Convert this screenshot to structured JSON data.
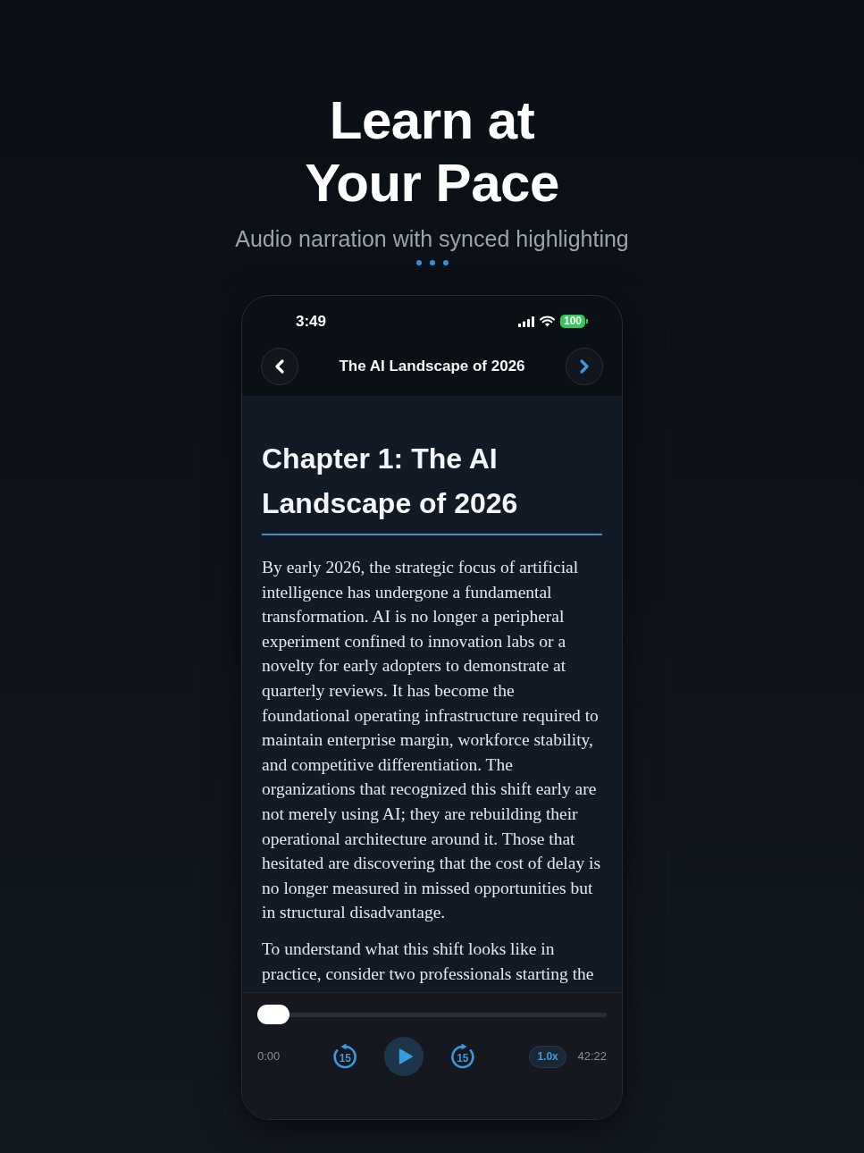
{
  "hero": {
    "title": "Learn at Your Pace",
    "subtitle": "Audio narration with synced highlighting"
  },
  "phone": {
    "status_bar": {
      "time": "3:49",
      "battery": "100"
    },
    "nav": {
      "title": "The AI Landscape of 2026"
    },
    "chapter": {
      "heading": "Chapter 1: The AI Landscape of 2026",
      "paragraphs": [
        "By early 2026, the strategic focus of artificial intelligence has undergone a fundamental transformation. AI is no longer a peripheral experiment confined to innovation labs or a novelty for early adopters to demonstrate at quarterly reviews. It has become the foundational operating infrastructure required to maintain enterprise margin, workforce stability, and competitive differentiation. The organizations that recognized this shift early are not merely using AI; they are rebuilding their operational architecture around it. Those that hesitated are discovering that the cost of delay is no longer measured in missed opportunities but in structural disadvantage.",
        "To understand what this shift looks like in practice, consider two professionals starting the"
      ]
    }
  },
  "player": {
    "level": 0,
    "elapsed": "0:00",
    "skip_back": "15",
    "skip_forward": "15",
    "speed": "1.0x",
    "duration": "42:22"
  }
}
